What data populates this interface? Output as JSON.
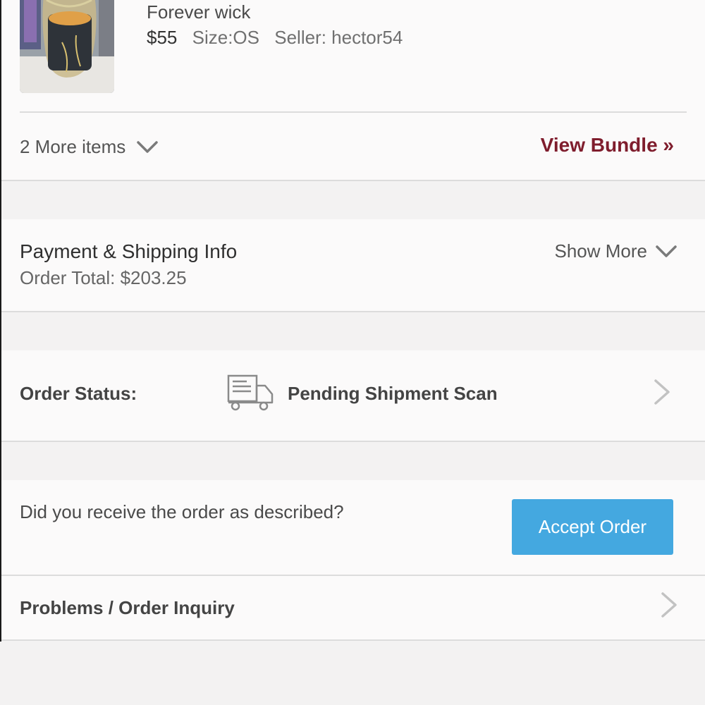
{
  "item": {
    "title": "Forever wick",
    "price": "$55",
    "size": "Size:OS",
    "seller": "Seller: hector54",
    "thumbnail_icon": "candle-photo"
  },
  "bundle": {
    "more_items": "2 More items",
    "view_bundle": "View Bundle »"
  },
  "payment": {
    "title": "Payment & Shipping Info",
    "order_total": "Order Total: $203.25",
    "show_more": "Show More"
  },
  "order_status": {
    "label": "Order Status:",
    "value": "Pending Shipment Scan",
    "icon": "truck-icon"
  },
  "accept": {
    "question": "Did you receive the order as described?",
    "button_label": "Accept Order"
  },
  "problems": {
    "label": "Problems / Order Inquiry"
  },
  "colors": {
    "accent_bundle": "#7f1d2d",
    "accept_button": "#44a8e0",
    "background": "#f3f2f2",
    "panel": "#fbfafa"
  }
}
